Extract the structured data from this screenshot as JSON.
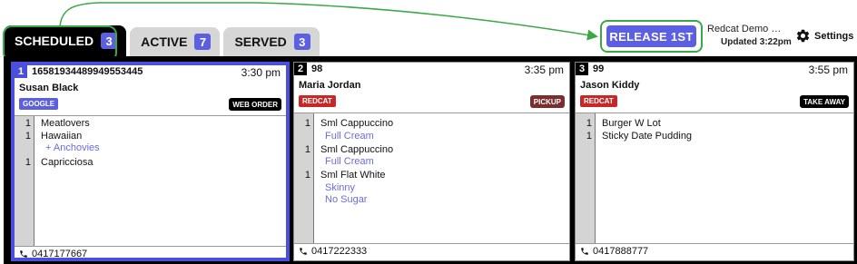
{
  "tabs": [
    {
      "label": "SCHEDULED",
      "count": "3"
    },
    {
      "label": "ACTIVE",
      "count": "7"
    },
    {
      "label": "SERVED",
      "count": "3"
    }
  ],
  "header": {
    "release_label": "RELEASE 1ST",
    "store_name": "Redcat Demo Ca...",
    "updated": "Updated 3:22pm",
    "settings_label": "Settings"
  },
  "colors": {
    "accent": "#5b5fe0",
    "highlight": "#3aa845",
    "google": "#5b5fe0",
    "redcat": "#c62828",
    "pickup": "#7a2e2e"
  },
  "orders": [
    {
      "index": "1",
      "id": "16581934489949553445",
      "time": "3:30 pm",
      "customer": "Susan Black",
      "source": "GOOGLE",
      "order_type": "WEB ORDER",
      "phone": "0417177667",
      "lines": [
        {
          "qty": "1",
          "name": "Meatlovers"
        },
        {
          "qty": "1",
          "name": "Hawaiian"
        },
        {
          "qty": "",
          "name": "+ Anchovies",
          "modifier": true
        },
        {
          "qty": "1",
          "name": "Capricciosa"
        }
      ]
    },
    {
      "index": "2",
      "id": "98",
      "time": "3:35 pm",
      "customer": "Maria Jordan",
      "source": "REDCAT",
      "order_type": "PICKUP",
      "phone": "0417222333",
      "lines": [
        {
          "qty": "1",
          "name": "Sml Cappuccino"
        },
        {
          "qty": "",
          "name": "Full Cream",
          "modifier": true
        },
        {
          "qty": "1",
          "name": "Sml Cappuccino"
        },
        {
          "qty": "",
          "name": "Full Cream",
          "modifier": true
        },
        {
          "qty": "1",
          "name": "Sml Flat White"
        },
        {
          "qty": "",
          "name": "Skinny",
          "modifier": true
        },
        {
          "qty": "",
          "name": "No Sugar",
          "modifier": true
        }
      ]
    },
    {
      "index": "3",
      "id": "99",
      "time": "3:55 pm",
      "customer": "Jason Kiddy",
      "source": "REDCAT",
      "order_type": "TAKE AWAY",
      "phone": "0417888777",
      "lines": [
        {
          "qty": "1",
          "name": "Burger W Lot"
        },
        {
          "qty": "1",
          "name": "Sticky Date Pudding"
        }
      ]
    }
  ]
}
